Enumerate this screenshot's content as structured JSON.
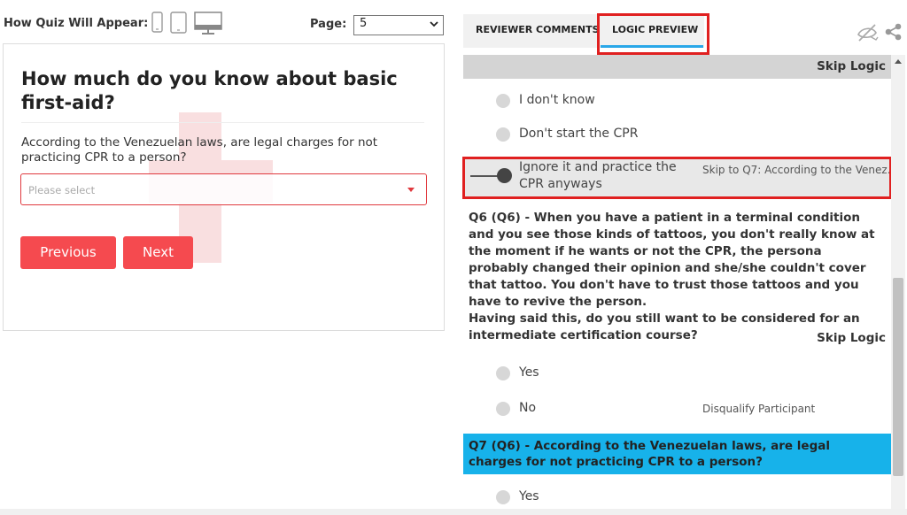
{
  "preview": {
    "appear_label": "How Quiz Will Appear:",
    "device_icons": [
      "phone-icon",
      "tablet-icon",
      "desktop-icon"
    ],
    "page_label": "Page:",
    "page_value": "5"
  },
  "quiz": {
    "title": "How much do you know about basic first-aid?",
    "question": "According to the Venezuelan laws, are legal charges for not practicing CPR to a person?",
    "select_placeholder": "Please select",
    "previous_label": "Previous",
    "next_label": "Next"
  },
  "reviewer": {
    "tabs": [
      {
        "label": "REVIEWER COMMENTS"
      },
      {
        "label": "LOGIC PREVIEW",
        "active": true
      }
    ],
    "skip_logic_label": "Skip Logic",
    "q5_options": [
      {
        "label": "I don't know",
        "logic": ""
      },
      {
        "label": "Don't start the CPR",
        "logic": ""
      },
      {
        "label": "Ignore it and practice the CPR anyways",
        "logic": "Skip to Q7: According to the Venez..."
      }
    ],
    "q6": {
      "text_line1": "Q6 (Q6) - When you have a patient in a terminal condition and you see those kinds of tattoos, you don't really know at the moment if he wants or not the CPR, the persona probably changed their opinion and she/she couldn't cover that tattoo. You don't have to trust those tattoos and you have to revive the person.",
      "text_line2": "Having said this, do you still want to be considered for an intermediate certification course?",
      "skip_logic_label": "Skip Logic",
      "options": [
        {
          "label": "Yes",
          "logic": ""
        },
        {
          "label": "No",
          "logic": "Disqualify Participant"
        }
      ]
    },
    "q7": {
      "text": "Q7 (Q6) - According to the Venezuelan laws, are legal charges for not practicing CPR to a person?",
      "options": [
        {
          "label": "Yes"
        }
      ]
    }
  },
  "colors": {
    "accent_red": "#f54a4f",
    "tab_underline": "#2aa7e8",
    "q7_highlight": "#17b2ea",
    "annotation_box": "#e02020"
  }
}
